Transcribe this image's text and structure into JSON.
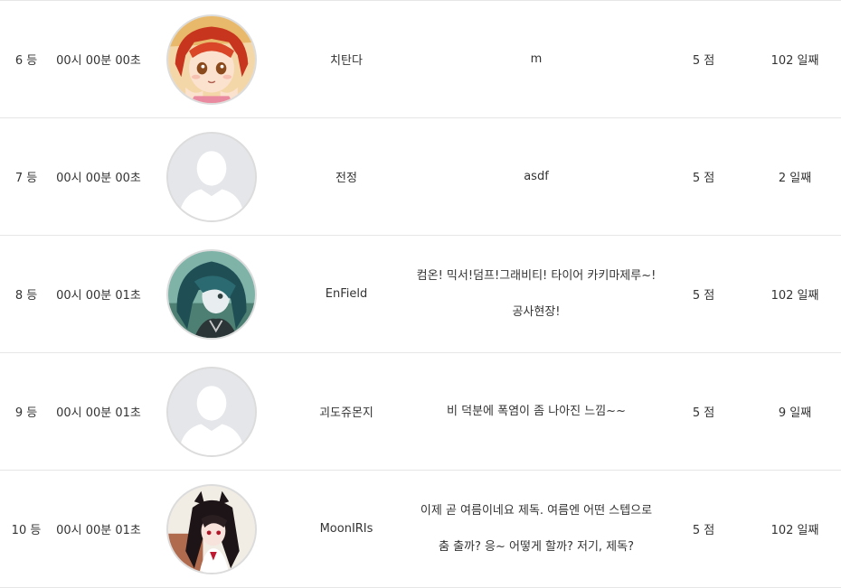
{
  "rows": [
    {
      "rank": "6 등",
      "time": "00시 00분 00초",
      "avatar": "anime-red-hair",
      "name": "치탄다",
      "message": [
        "m"
      ],
      "score": "5 점",
      "days": "102 일째"
    },
    {
      "rank": "7 등",
      "time": "00시 00분 00초",
      "avatar": "default-user",
      "name": "전정",
      "message": [
        "asdf"
      ],
      "score": "5 점",
      "days": "2 일째"
    },
    {
      "rank": "8 등",
      "time": "00시 00분 01초",
      "avatar": "anime-teal-hair",
      "name": "EnField",
      "message": [
        "컴온! 믹서!덤프!그래비티! 타이어 카키마제루~!",
        "공사현장!"
      ],
      "score": "5 점",
      "days": "102 일째"
    },
    {
      "rank": "9 등",
      "time": "00시 00분 01초",
      "avatar": "default-user",
      "name": "괴도쥬몬지",
      "message": [
        "비 덕분에 폭염이 좀 나아진 느낌~~"
      ],
      "score": "5 점",
      "days": "9 일째"
    },
    {
      "rank": "10 등",
      "time": "00시 00분 01초",
      "avatar": "anime-black-hair",
      "name": "MoonIRIs",
      "message": [
        "이제 곧 여름이네요 제독. 여름엔 어떤 스텝으로",
        "춤 출까? 응~ 어떻게 할까? 저기, 제독?"
      ],
      "score": "5 점",
      "days": "102 일째"
    }
  ]
}
